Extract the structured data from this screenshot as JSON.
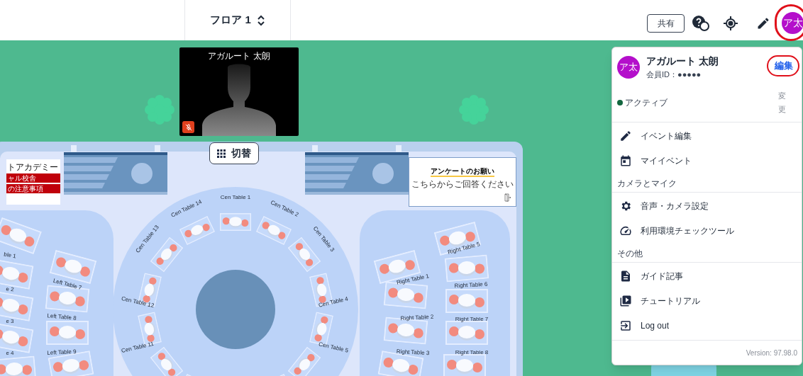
{
  "header": {
    "floor_label": "フロア 1",
    "share_button": "共有",
    "avatar": {
      "initials": "ア太",
      "highlighted": true
    }
  },
  "video_tile": {
    "name": "アガルート 太朗",
    "muted": true
  },
  "switch_button": "切替",
  "posters": [
    {
      "kind": "notice",
      "lines": [
        "トアカデミー",
        "ャル校舎",
        "の注意事項"
      ]
    },
    {
      "kind": "survey",
      "title": "アンケートのお願い",
      "subtitle": "こちらからご回答ください"
    }
  ],
  "center_tables": [
    {
      "label": "Cen Table 1"
    },
    {
      "label": "Cen Table 2"
    },
    {
      "label": "Cen Table 3"
    },
    {
      "label": "Cen Table 4"
    },
    {
      "label": "Cen Table 5"
    },
    {
      "label": "Cen Table 11"
    },
    {
      "label": "Cen Table 12"
    },
    {
      "label": "Cen Table 13"
    },
    {
      "label": "Cen Table 14"
    }
  ],
  "left_tables": [
    {
      "label": "ble 1"
    },
    {
      "label": "e 2"
    },
    {
      "label": "e 3"
    },
    {
      "label": "e 4"
    },
    {
      "label": "Left Table 7"
    },
    {
      "label": "Left Table 8"
    },
    {
      "label": "Left Table 9"
    }
  ],
  "right_tables": [
    {
      "label": "Right Table 1"
    },
    {
      "label": "Right Table 2"
    },
    {
      "label": "Right Table 3"
    },
    {
      "label": "Right Table 5"
    },
    {
      "label": "Right Table 6"
    },
    {
      "label": "Right Table 7"
    },
    {
      "label": "Right Table 8"
    }
  ],
  "user_menu": {
    "avatar": "ア太",
    "name": "アガルート 太朗",
    "member_id": "会員ID：●●●●●",
    "edit_link": {
      "label": "編集",
      "highlighted": true
    },
    "status": "アクティブ",
    "change_link": "変更",
    "sections": [
      {
        "items": [
          {
            "label": "イベント編集"
          },
          {
            "label": "マイイベント"
          }
        ]
      },
      {
        "header": "カメラとマイク",
        "items": [
          {
            "label": "音声・カメラ設定"
          },
          {
            "label": "利用環境チェックツール"
          }
        ]
      },
      {
        "header": "その他",
        "items": [
          {
            "label": "ガイド記事"
          },
          {
            "label": "チュートリアル"
          },
          {
            "label": "Log out"
          }
        ]
      }
    ],
    "version": "Version: 97.98.0"
  }
}
